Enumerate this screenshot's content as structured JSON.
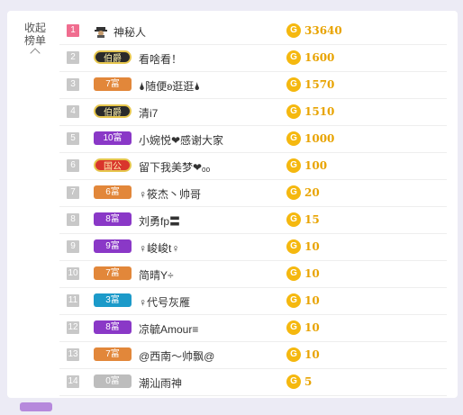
{
  "collapse": {
    "line1": "收起",
    "line2": "榜单"
  },
  "currency_glyph": "G",
  "rows": [
    {
      "rank": "1",
      "badge": "",
      "name": "神秘人",
      "amount": "33640"
    },
    {
      "rank": "2",
      "badge": "伯爵",
      "name": "看啥看！",
      "amount": "1600"
    },
    {
      "rank": "3",
      "badge": "7富",
      "name": "🌢随便ʚ逛逛🌢",
      "amount": "1570"
    },
    {
      "rank": "4",
      "badge": "伯爵",
      "name": "清i7",
      "amount": "1510"
    },
    {
      "rank": "5",
      "badge": "10富",
      "name": "小婉悦❤感谢大家",
      "amount": "1000"
    },
    {
      "rank": "6",
      "badge": "国公",
      "name": "留下我美梦❤ₒₒ",
      "amount": "100"
    },
    {
      "rank": "7",
      "badge": "6富",
      "name": "♀筱杰丶帅哥",
      "amount": "20"
    },
    {
      "rank": "8",
      "badge": "8富",
      "name": "刘勇fp〓",
      "amount": "15"
    },
    {
      "rank": "9",
      "badge": "9富",
      "name": "♀峻峻t♀",
      "amount": "10"
    },
    {
      "rank": "10",
      "badge": "7富",
      "name": "简晴Y÷",
      "amount": "10"
    },
    {
      "rank": "11",
      "badge": "3富",
      "name": "♀代号灰雁",
      "amount": "10"
    },
    {
      "rank": "12",
      "badge": "8富",
      "name": "凉毓Amour≡",
      "amount": "10"
    },
    {
      "rank": "13",
      "badge": "7富",
      "name": "@西南～帅飘@",
      "amount": "10"
    },
    {
      "rank": "14",
      "badge": "0富",
      "name": "潮汕雨神",
      "amount": "5"
    }
  ]
}
